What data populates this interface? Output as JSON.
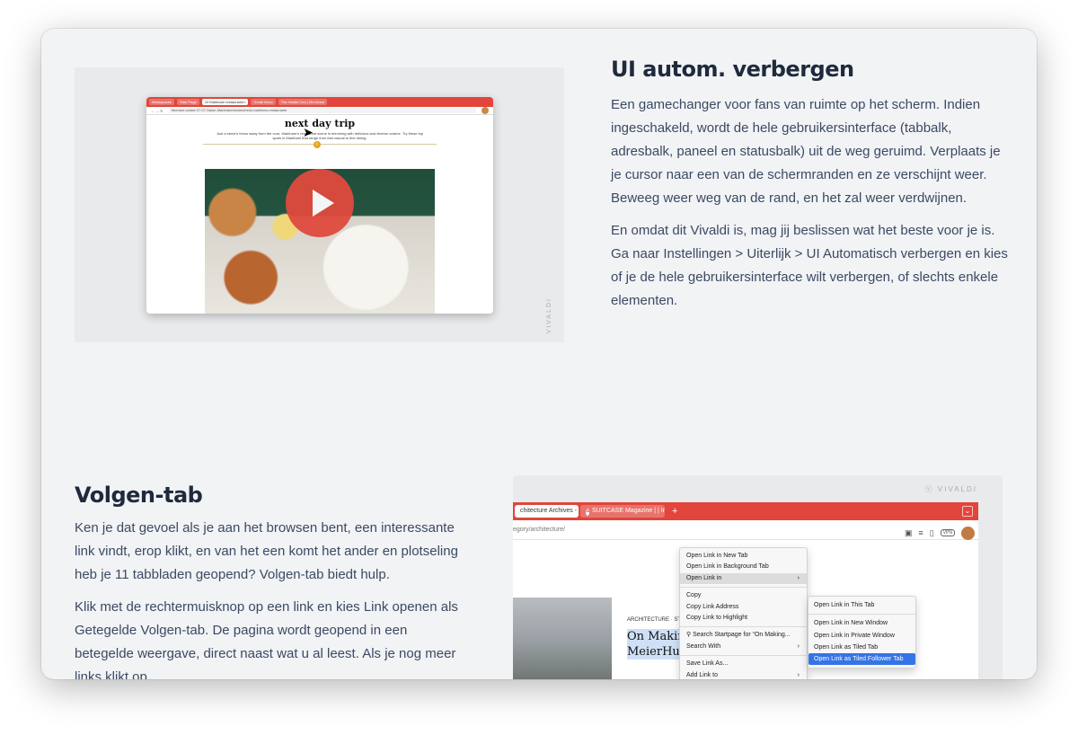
{
  "section1": {
    "title": "UI autom. verbergen",
    "paragraph1": "Een gamechanger voor fans van ruimte op het scherm. Indien ingeschakeld, wordt de hele gebruikersinterface (tabbalk, adresbalk, paneel en statusbalk) uit de weg geruimd. Verplaats je je cursor naar een van de schermranden en ze verschijnt weer. Beweeg weer weg van de rand, en het zal weer verdwijnen.",
    "paragraph2": "En omdat dit Vivaldi is, mag jij beslissen wat het beste voor je is. Ga naar Instellingen > Uiterlijk > UI Automatisch verbergen en kies of je de hele gebruikersinterface wilt verbergen, of slechts enkele elementen.",
    "brand": "VIVALDI",
    "video": {
      "tabs": [
        "Workspaces",
        "Start Page",
        "10 Markham restaurants t",
        "Gmail Inbox",
        "The Hostel Cnd | Shr bears"
      ],
      "url": "freedom.ca/ant-07-07-Salon-Markham/stories/best-markham-restaurants",
      "headline": "next day trip",
      "subtext": "Just a stone's throw away from the core, Markham's restaurant scene is brimming with delicious and diverse cuisine. Try these top spots in Markham that range from fast casual to fine dining.",
      "badge": "t"
    }
  },
  "section2": {
    "title": "Volgen-tab",
    "paragraph1": "Ken je dat gevoel als je aan het browsen bent, een interessante link vindt, erop klikt, en van het een komt het ander en plotseling heb je 11 tabbladen geopend? Volgen-tab biedt hulp.",
    "paragraph2": "Klik met de rechtermuisknop op een link en kies Link openen als Getegelde Volgen-tab. De pagina wordt geopend in een betegelde weergave, direct naast wat u al leest. Als je nog meer links klikt op",
    "brand": "VIVALDI",
    "screenshot": {
      "tab1": "chitecture Archives - Ki",
      "tab2": "SUITCASE Magazine | | Ins",
      "tab2_logo": "S",
      "url": "egory/architecture/",
      "vpn": "VPN",
      "category": "ARCHITECTURE · STU",
      "article_title_line1": "On Makin",
      "article_title_line2": "MeierHug",
      "context_menu": [
        "Open Link in New Tab",
        "Open Link in Background Tab",
        "Open Link in",
        "Copy",
        "Copy Link Address",
        "Copy Link to Highlight",
        "Search Startpage for “On Making...",
        "Search With",
        "Save Link As...",
        "Add Link to"
      ],
      "submenu": [
        "Open Link in This Tab",
        "Open Link in New Window",
        "Open Link in Private Window",
        "Open Link as Tiled Tab",
        "Open Link as Tiled Follower Tab"
      ]
    }
  }
}
